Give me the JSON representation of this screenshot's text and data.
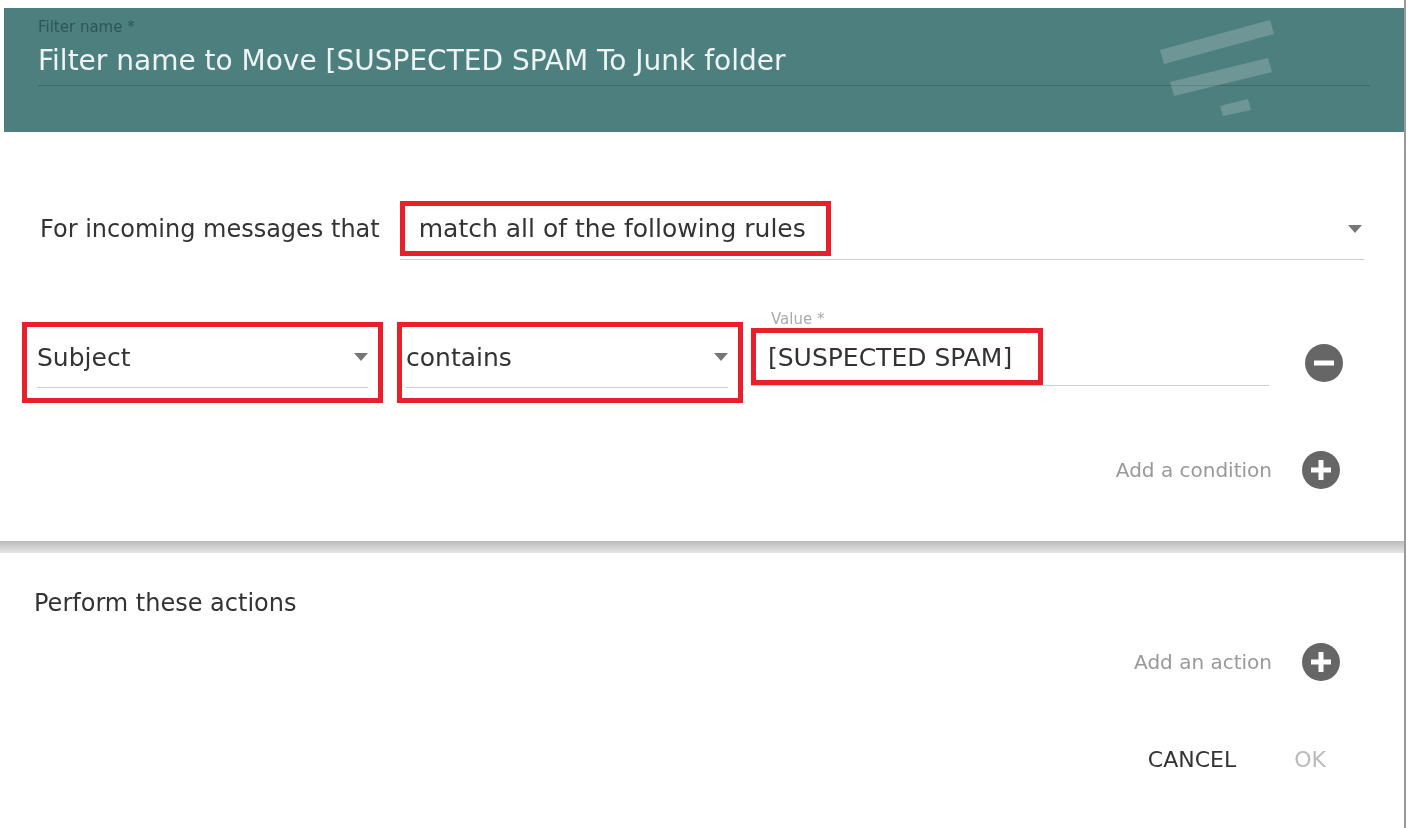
{
  "header": {
    "label": "Filter name *",
    "value": "Filter name to Move [SUSPECTED SPAM To Junk folder"
  },
  "conditions": {
    "intro": "For incoming messages that",
    "match": {
      "value": "match all of the following rules",
      "highlighted": true
    },
    "rules": [
      {
        "field": {
          "value": "Subject",
          "highlighted": true
        },
        "operator": {
          "value": "contains",
          "highlighted": true
        },
        "input": {
          "label": "Value *",
          "value": "[SUSPECTED SPAM]",
          "highlighted": true
        }
      }
    ],
    "add_label": "Add a condition"
  },
  "actions": {
    "title": "Perform these actions",
    "add_label": "Add an action"
  },
  "buttons": [
    {
      "label": "CANCEL",
      "disabled": false
    },
    {
      "label": "OK",
      "disabled": true
    }
  ]
}
